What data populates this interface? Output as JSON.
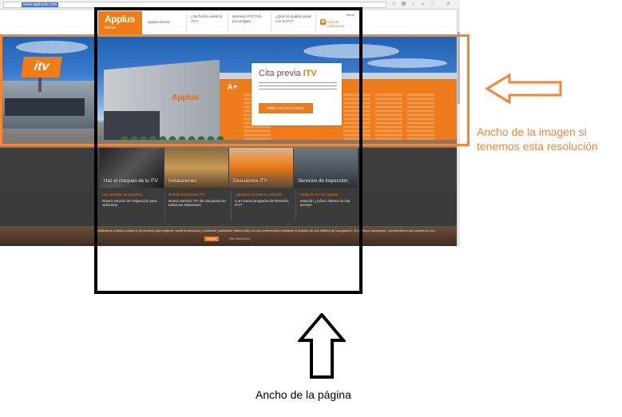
{
  "browser": {
    "url": "www.applusitv.com",
    "icons": [
      "star-icon",
      "reader-icon",
      "download-icon",
      "home-icon",
      "bookmark-icon",
      "menu-icon"
    ]
  },
  "site": {
    "logo": {
      "main": "Applus",
      "sub": "Iteuve"
    },
    "nav": [
      "Applus Iteuve",
      "¿Ha hecho usted la ITV?",
      "Itinerario ITV/ TAX porcentajes",
      "¿Qué ha podido pasar con la ITV?"
    ],
    "rss_label": "Red de estaciones",
    "menu_label": "Menú",
    "hero": {
      "promo_title": "Cita previa",
      "promo_title_highlight": "ITV",
      "promo_button": "PIDE CITA ITV AHORA",
      "building_logo": "Applus",
      "sign_itv": "itv",
      "sign_ae": "A+"
    },
    "tiles": [
      "Haz el chequeo de tu ITV",
      "Instalaciones",
      "Descuentos ITV",
      "Servicios de inspección"
    ],
    "news": [
      {
        "head": "Las ventajas de nuestros",
        "body": "Nuevo servicio de inspección para vehículos"
      },
      {
        "head": "Red de estaciones ITV",
        "body": "Nuevo servicio ITV de cita previa en todas las estaciones"
      },
      {
        "head": "¿Quieres someter tu vehículo",
        "body": "a un nuevo programa de Revisión ITV?"
      },
      {
        "head": "Pasar la ITV en nuestra",
        "body": "estación ¿Cómo obtener la cita previa?"
      }
    ],
    "cookie": {
      "text": "Utilizamos cookies propias y de terceros para mejorar nuestros servicios y mostrarle publicidad relacionada con sus preferencias mediante el análisis de sus hábitos de navegación. Si continua navegando, consideramos que acepta su uso.",
      "button": "Aceptar",
      "more": "Más información"
    }
  },
  "annotations": {
    "image_width_label_line1": "Ancho de la imagen si",
    "image_width_label_line2": "tenemos esta resolución",
    "page_width_label": "Ancho de la página"
  },
  "colors": {
    "brand_orange": "#f07c18",
    "annotation_orange": "#f58634",
    "frame_black": "#000000",
    "dark_band": "#3d3d3d"
  }
}
